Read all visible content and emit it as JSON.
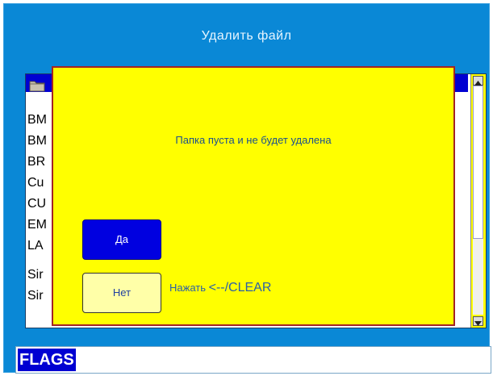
{
  "window": {
    "title": "Удалить файл"
  },
  "file_list": {
    "items": [
      "BM",
      "BM",
      "BR",
      "Cu",
      "CU",
      "EM",
      "LA",
      "Sir",
      "Sir"
    ],
    "selected_icon": "folder-icon"
  },
  "dialog": {
    "message": "Папка пуста и не будет удалена",
    "yes_label": "Да",
    "no_label": "Нет",
    "hint_prefix": "Нажать ",
    "hint_key": "<--/CLEAR"
  },
  "bottom": {
    "value": "FLAGS"
  },
  "colors": {
    "window_bg": "#0a88d6",
    "dialog_bg": "#ffff00",
    "dialog_border": "#a32424",
    "selection": "#0000d2",
    "yes_button": "#0000e0"
  }
}
